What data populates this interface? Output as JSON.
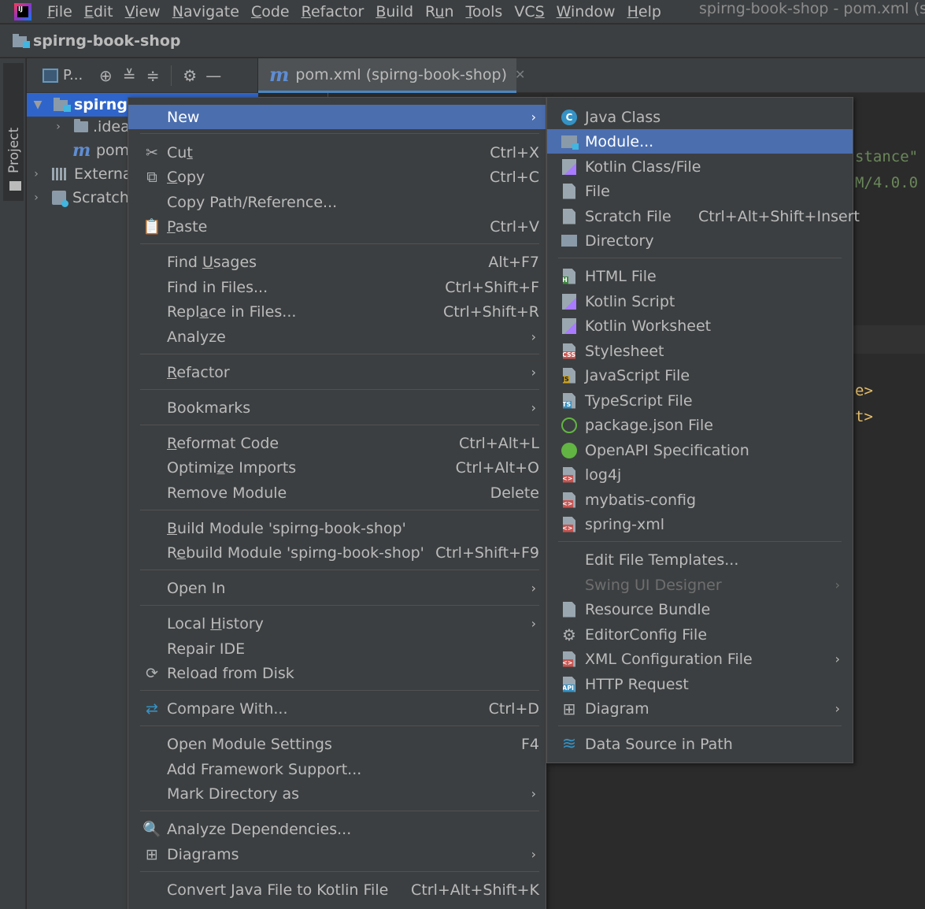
{
  "menubar": {
    "items": [
      {
        "pre": "",
        "mn": "F",
        "post": "ile"
      },
      {
        "pre": "",
        "mn": "E",
        "post": "dit"
      },
      {
        "pre": "",
        "mn": "V",
        "post": "iew"
      },
      {
        "pre": "",
        "mn": "N",
        "post": "avigate"
      },
      {
        "pre": "",
        "mn": "C",
        "post": "ode"
      },
      {
        "pre": "",
        "mn": "R",
        "post": "efactor"
      },
      {
        "pre": "",
        "mn": "B",
        "post": "uild"
      },
      {
        "pre": "R",
        "mn": "u",
        "post": "n"
      },
      {
        "pre": "",
        "mn": "T",
        "post": "ools"
      },
      {
        "pre": "VC",
        "mn": "S",
        "post": ""
      },
      {
        "pre": "",
        "mn": "W",
        "post": "indow"
      },
      {
        "pre": "",
        "mn": "H",
        "post": "elp"
      }
    ],
    "window_title": "spirng-book-shop - pom.xml (spi"
  },
  "navbar": {
    "project_name": "spirng-book-shop"
  },
  "left_stripe": {
    "project_tab": "Project"
  },
  "project_panel": {
    "header_label": "P..."
  },
  "editor": {
    "tab_label": "pom.xml (spirng-book-shop)",
    "code_fragments": [
      "stance\"",
      "M/4.0.0",
      "e>",
      "t>"
    ]
  },
  "tree": {
    "root": "spirng-",
    "idea": ".idea",
    "pom": "pom",
    "external": "External",
    "scratches": "Scratche"
  },
  "context_menu": {
    "new": "New",
    "cut": {
      "pre": "Cu",
      "u": "t",
      "post": "",
      "shortcut": "Ctrl+X"
    },
    "copy": {
      "pre": "",
      "u": "C",
      "post": "opy",
      "shortcut": "Ctrl+C"
    },
    "copy_path": "Copy Path/Reference...",
    "paste": {
      "pre": "",
      "u": "P",
      "post": "aste",
      "shortcut": "Ctrl+V"
    },
    "find_usages": {
      "pre": "Find ",
      "u": "U",
      "post": "sages",
      "shortcut": "Alt+F7"
    },
    "find_in_files": {
      "label": "Find in Files...",
      "shortcut": "Ctrl+Shift+F"
    },
    "replace_in_files": {
      "pre": "Repl",
      "u": "a",
      "post": "ce in Files...",
      "shortcut": "Ctrl+Shift+R"
    },
    "analyze": "Analyze",
    "refactor": {
      "pre": "",
      "u": "R",
      "post": "efactor"
    },
    "bookmarks": "Bookmarks",
    "reformat": {
      "pre": "",
      "u": "R",
      "post": "eformat Code",
      "shortcut": "Ctrl+Alt+L"
    },
    "optimize": {
      "pre": "Optimi",
      "u": "z",
      "post": "e Imports",
      "shortcut": "Ctrl+Alt+O"
    },
    "remove_module": {
      "label": "Remove Module",
      "shortcut": "Delete"
    },
    "build_module": {
      "pre": "",
      "u": "B",
      "post": "uild Module 'spirng-book-shop'"
    },
    "rebuild_module": {
      "pre": "R",
      "u": "e",
      "post": "build Module 'spirng-book-shop'",
      "shortcut": "Ctrl+Shift+F9"
    },
    "open_in": "Open In",
    "local_history": {
      "pre": "Local ",
      "u": "H",
      "post": "istory"
    },
    "repair_ide": "Repair IDE",
    "reload": "Reload from Disk",
    "compare": {
      "label": "Compare With...",
      "shortcut": "Ctrl+D"
    },
    "module_settings": {
      "label": "Open Module Settings",
      "shortcut": "F4"
    },
    "framework": "Add Framework Support...",
    "mark_dir": "Mark Directory as",
    "analyze_deps": "Analyze Dependencies...",
    "diagrams": "Diagrams",
    "convert": {
      "label": "Convert Java File to Kotlin File",
      "shortcut": "Ctrl+Alt+Shift+K"
    }
  },
  "new_submenu": {
    "java_class": "Java Class",
    "module": "Module...",
    "kotlin_class": "Kotlin Class/File",
    "file": "File",
    "scratch": {
      "label": "Scratch File",
      "shortcut": "Ctrl+Alt+Shift+Insert"
    },
    "directory": "Directory",
    "html": "HTML File",
    "kotlin_script": "Kotlin Script",
    "kotlin_worksheet": "Kotlin Worksheet",
    "stylesheet": "Stylesheet",
    "javascript": "JavaScript File",
    "typescript": "TypeScript File",
    "package_json": "package.json File",
    "openapi": "OpenAPI Specification",
    "log4j": "log4j",
    "mybatis": "mybatis-config",
    "spring_xml": "spring-xml",
    "edit_templates": "Edit File Templates...",
    "swing": "Swing UI Designer",
    "resource_bundle": "Resource Bundle",
    "editorconfig": "EditorConfig File",
    "xml_config": "XML Configuration File",
    "http_request": "HTTP Request",
    "diagram": "Diagram",
    "data_source": "Data Source in Path"
  },
  "icon_tags": {
    "html": "H",
    "css": "CSS",
    "js": "JS",
    "ts": "TS",
    "api": "API",
    "xml": "<>",
    "java": "C"
  },
  "colors": {
    "highlight": "#4b6eaf",
    "tree_selection": "#2f65ca",
    "background": "#3c3f41",
    "editor": "#2b2b2b"
  }
}
